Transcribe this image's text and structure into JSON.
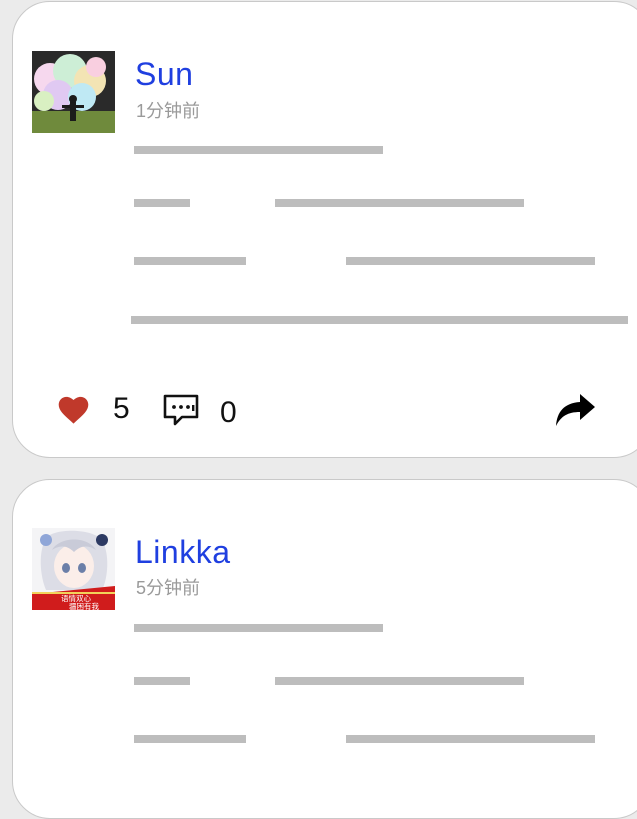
{
  "posts": [
    {
      "author": "Sun",
      "time": "1分钟前",
      "likes": "5",
      "comments": "0",
      "avatar_icon": "cloud-landscape-avatar",
      "content_lines": 5
    },
    {
      "author": "Linkka",
      "time": "5分钟前",
      "avatar_icon": "anime-girl-avatar",
      "avatar_caption": [
        "语情双心",
        "疆困有我"
      ]
    }
  ],
  "colors": {
    "author_name": "#1f3fe0",
    "timestamp": "#9a9a9a",
    "like_heart": "#c0392b",
    "placeholder_bar": "#bdbdbd",
    "background": "#ebebeb"
  }
}
